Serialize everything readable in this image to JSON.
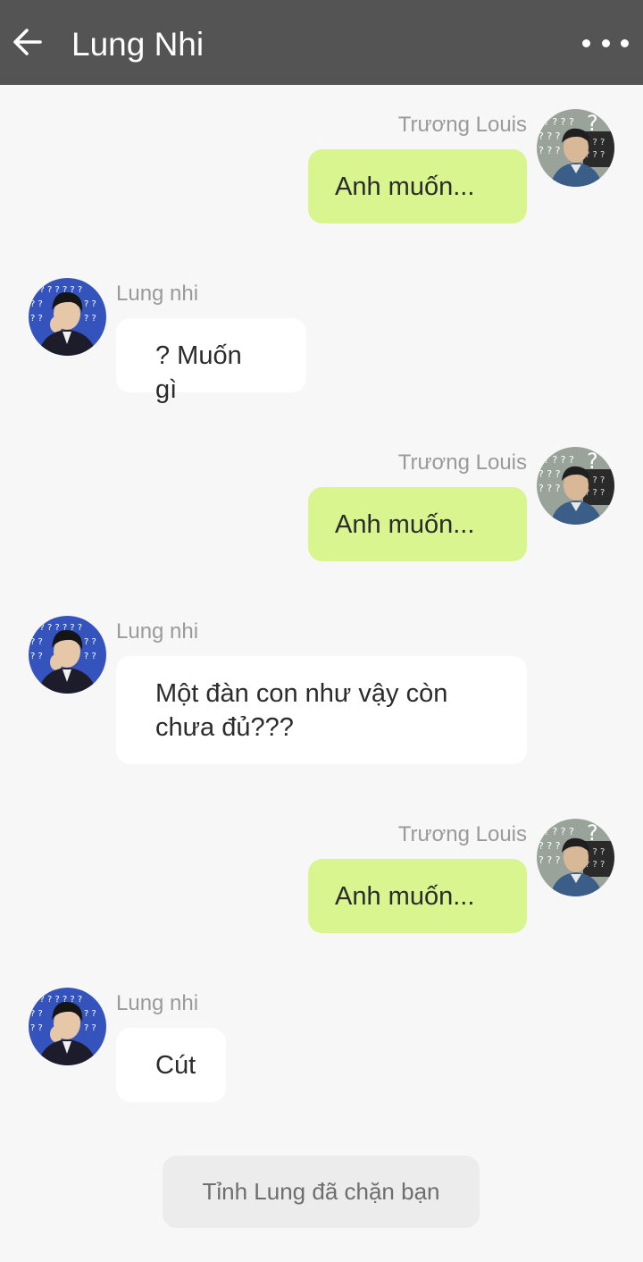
{
  "header": {
    "title": "Lung Nhi",
    "back_icon": "arrow-left-icon",
    "more_icon": "more-horizontal-icon",
    "background": "#545454"
  },
  "colors": {
    "sent_bubble": "#d8f590",
    "received_bubble": "#ffffff",
    "background": "#f7f7f7",
    "name_text": "#9a9a9a"
  },
  "messages": [
    {
      "sender": "Trương Louis",
      "text": "Anh muốn...",
      "direction": "sent"
    },
    {
      "sender": "Lung nhi",
      "text": "? Muốn gì",
      "direction": "received"
    },
    {
      "sender": "Trương Louis",
      "text": "Anh muốn...",
      "direction": "sent"
    },
    {
      "sender": "Lung nhi",
      "text": "Một đàn con như vậy còn chưa đủ???",
      "direction": "received"
    },
    {
      "sender": "Trương Louis",
      "text": "Anh muốn...",
      "direction": "sent"
    },
    {
      "sender": "Lung nhi",
      "text": "Cút",
      "direction": "received"
    }
  ],
  "notice": "Tỉnh Lung đã chặn bạn"
}
